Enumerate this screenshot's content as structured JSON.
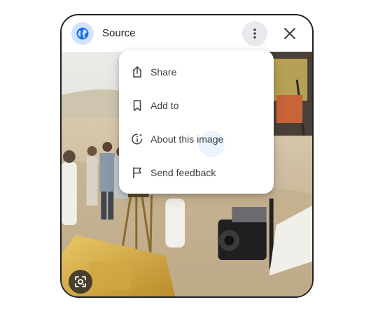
{
  "header": {
    "source_label": "Source",
    "source_icon": "globe-icon",
    "more_icon": "more-vert-icon",
    "close_icon": "close-icon"
  },
  "menu": {
    "items": [
      {
        "label": "Share",
        "icon": "share-icon"
      },
      {
        "label": "Add to",
        "icon": "bookmark-icon"
      },
      {
        "label": "About this image",
        "icon": "info-sparkle-icon"
      },
      {
        "label": "Send feedback",
        "icon": "flag-icon"
      }
    ]
  },
  "image": {
    "lens_icon": "lens-icon"
  },
  "colors": {
    "accent": "#1a73e8",
    "badge_bg": "#d3e3fd",
    "text": "#202124"
  }
}
